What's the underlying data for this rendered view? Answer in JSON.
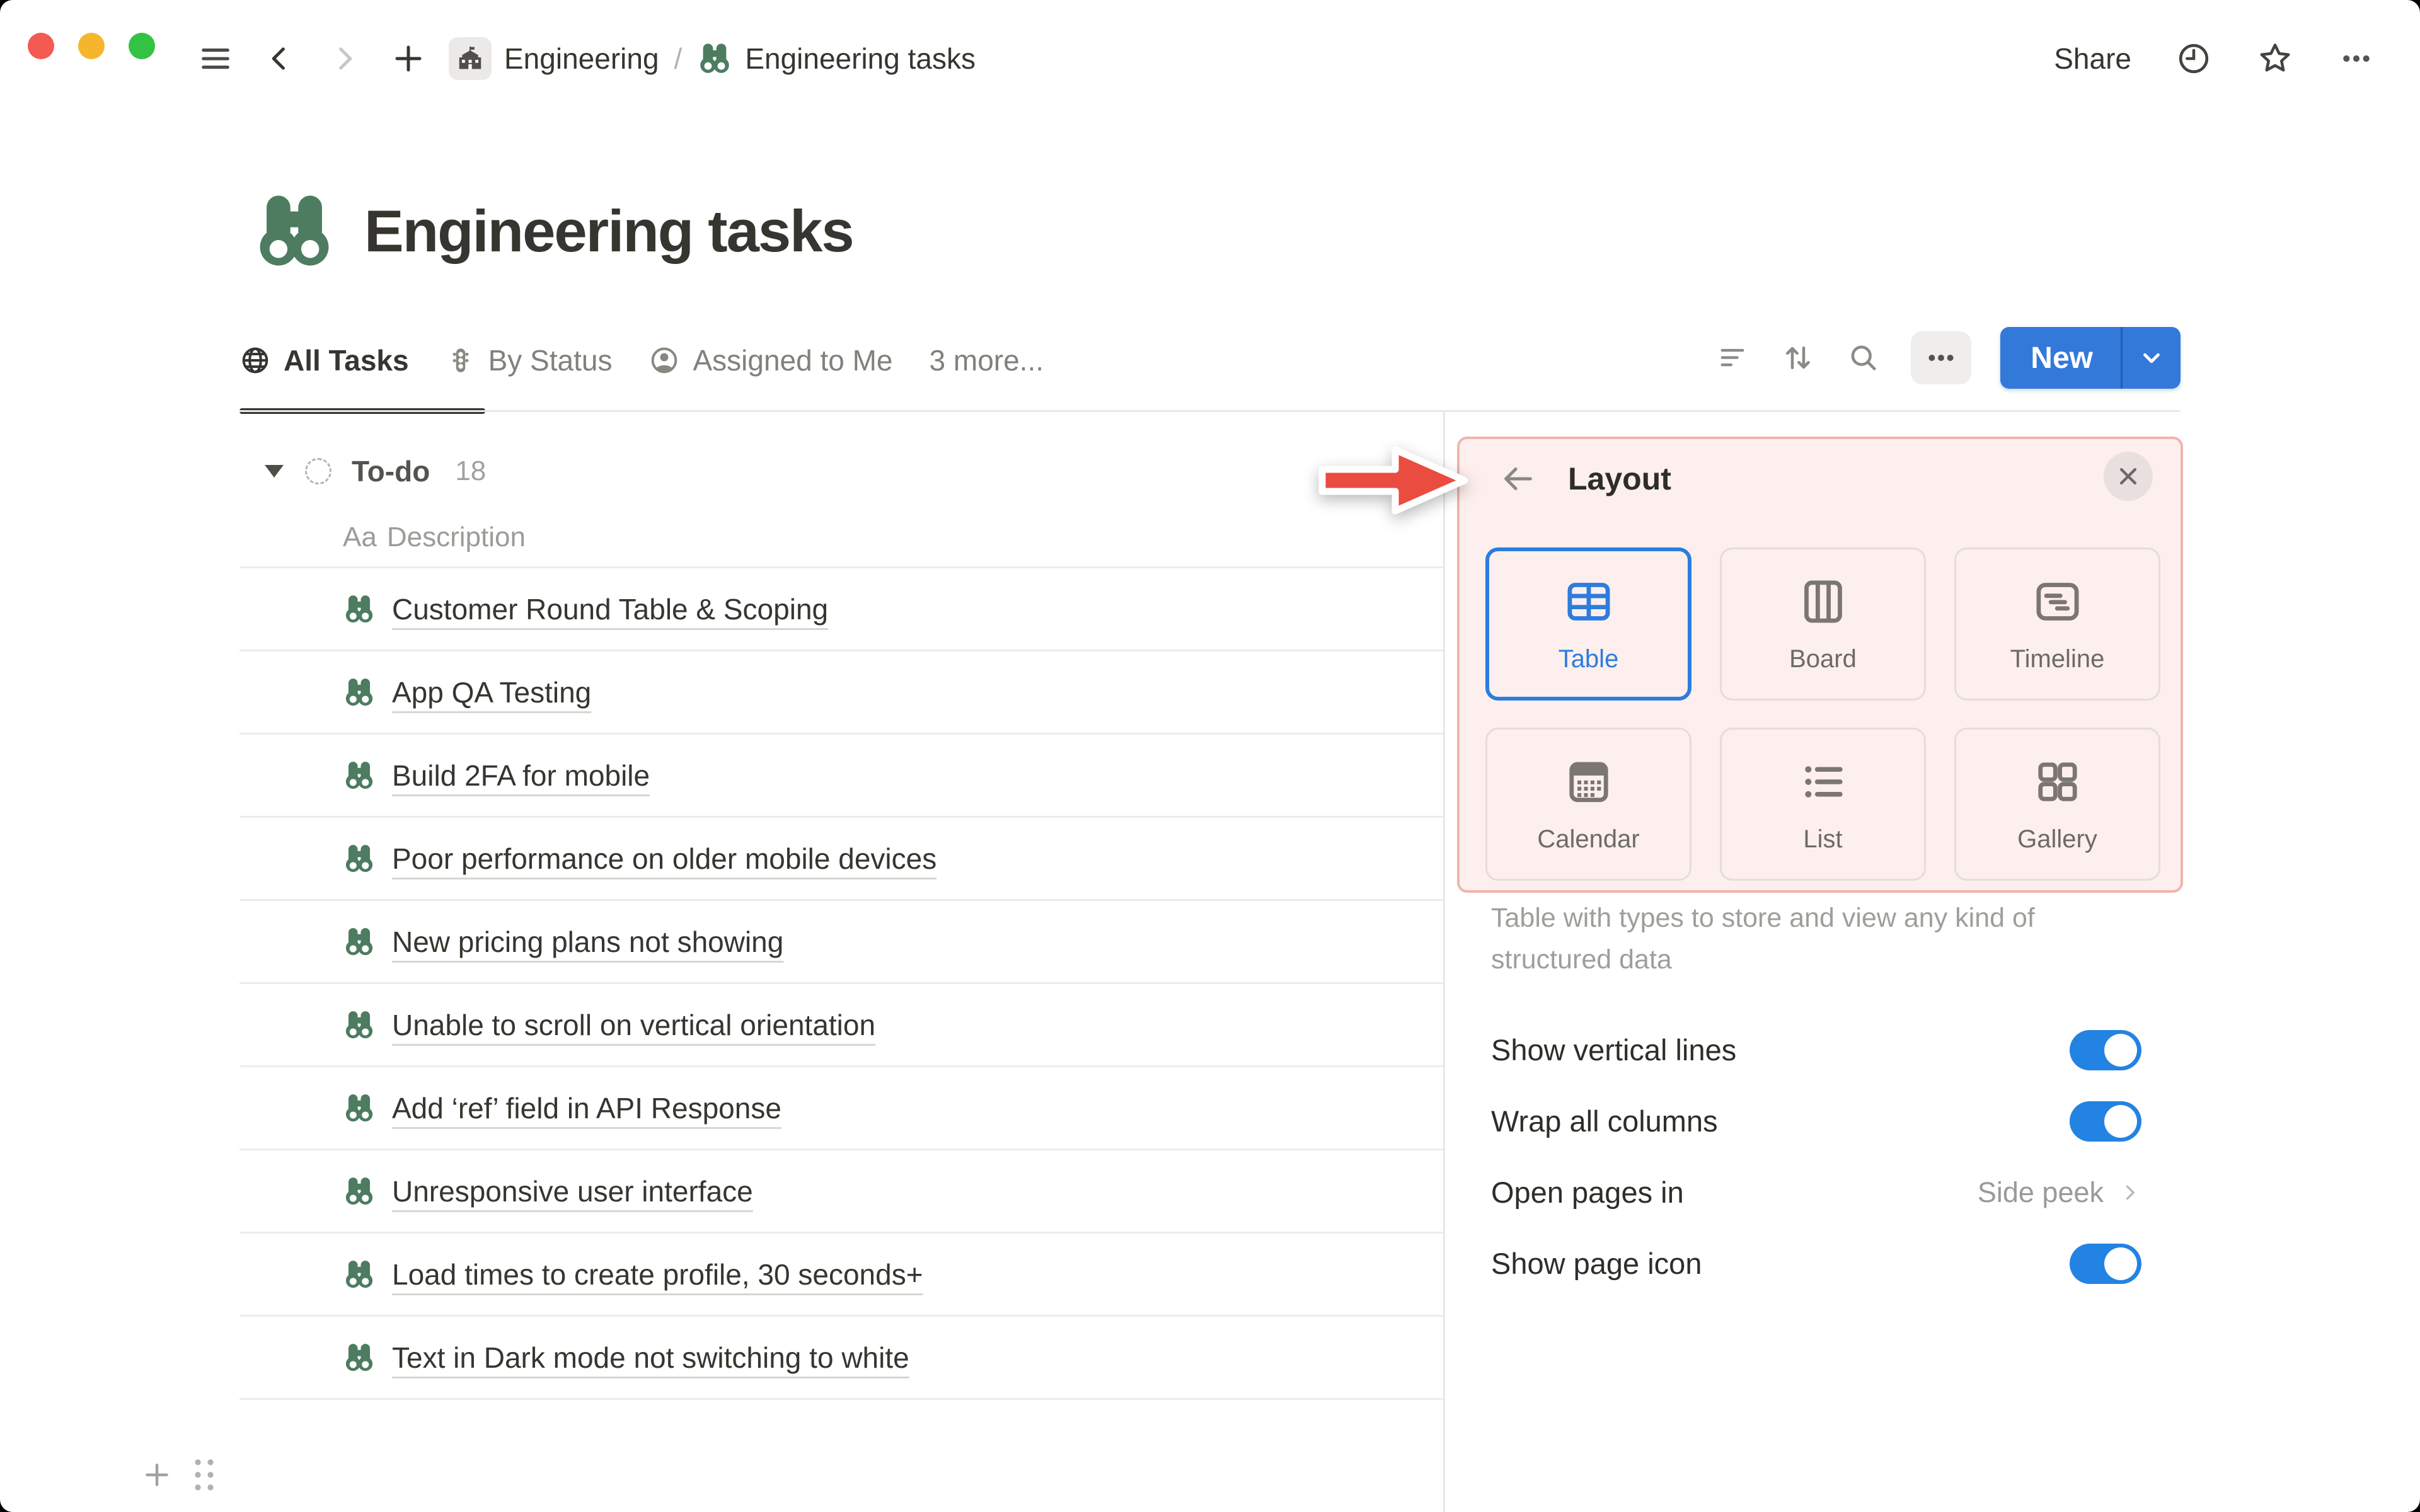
{
  "topbar": {
    "breadcrumb": {
      "workspace": "Engineering",
      "separator": "/",
      "page": "Engineering tasks"
    },
    "share_label": "Share"
  },
  "page": {
    "title": "Engineering tasks"
  },
  "tabs": {
    "items": [
      {
        "label": "All Tasks",
        "active": true
      },
      {
        "label": "By Status",
        "active": false
      },
      {
        "label": "Assigned to Me",
        "active": false
      },
      {
        "label": "3 more...",
        "active": false
      }
    ]
  },
  "toolbar": {
    "new_label": "New"
  },
  "table": {
    "group": {
      "name": "To-do",
      "count": "18"
    },
    "header": {
      "type_glyph": "Aa",
      "label": "Description"
    },
    "rows": [
      {
        "title": "Customer Round Table & Scoping"
      },
      {
        "title": "App QA Testing"
      },
      {
        "title": "Build 2FA for mobile"
      },
      {
        "title": "Poor performance on older mobile devices"
      },
      {
        "title": "New pricing plans not showing"
      },
      {
        "title": "Unable to scroll on vertical orientation"
      },
      {
        "title": "Add ‘ref’ field in API Response"
      },
      {
        "title": "Unresponsive user interface"
      },
      {
        "title": "Load times to create profile, 30 seconds+"
      },
      {
        "title": "Text in Dark mode not switching to white"
      }
    ]
  },
  "panel": {
    "title": "Layout",
    "options": [
      {
        "label": "Table",
        "selected": true
      },
      {
        "label": "Board",
        "selected": false
      },
      {
        "label": "Timeline",
        "selected": false
      },
      {
        "label": "Calendar",
        "selected": false
      },
      {
        "label": "List",
        "selected": false
      },
      {
        "label": "Gallery",
        "selected": false
      }
    ],
    "description": "Table with types to store and view any kind of structured data",
    "settings": [
      {
        "label": "Show vertical lines",
        "type": "toggle",
        "value": "on"
      },
      {
        "label": "Wrap all columns",
        "type": "toggle",
        "value": "on"
      },
      {
        "label": "Open pages in",
        "type": "value",
        "value": "Side peek"
      },
      {
        "label": "Show page icon",
        "type": "toggle",
        "value": "on"
      }
    ]
  },
  "colors": {
    "accent_blue": "#2383e2",
    "icon_green": "#4d7c60",
    "highlight_pink_bg": "#fcefee",
    "highlight_pink_border": "#f1b4ad",
    "annotation_red": "#ea4c40",
    "text_dark": "#37352f",
    "text_gray": "#9b9a97"
  }
}
